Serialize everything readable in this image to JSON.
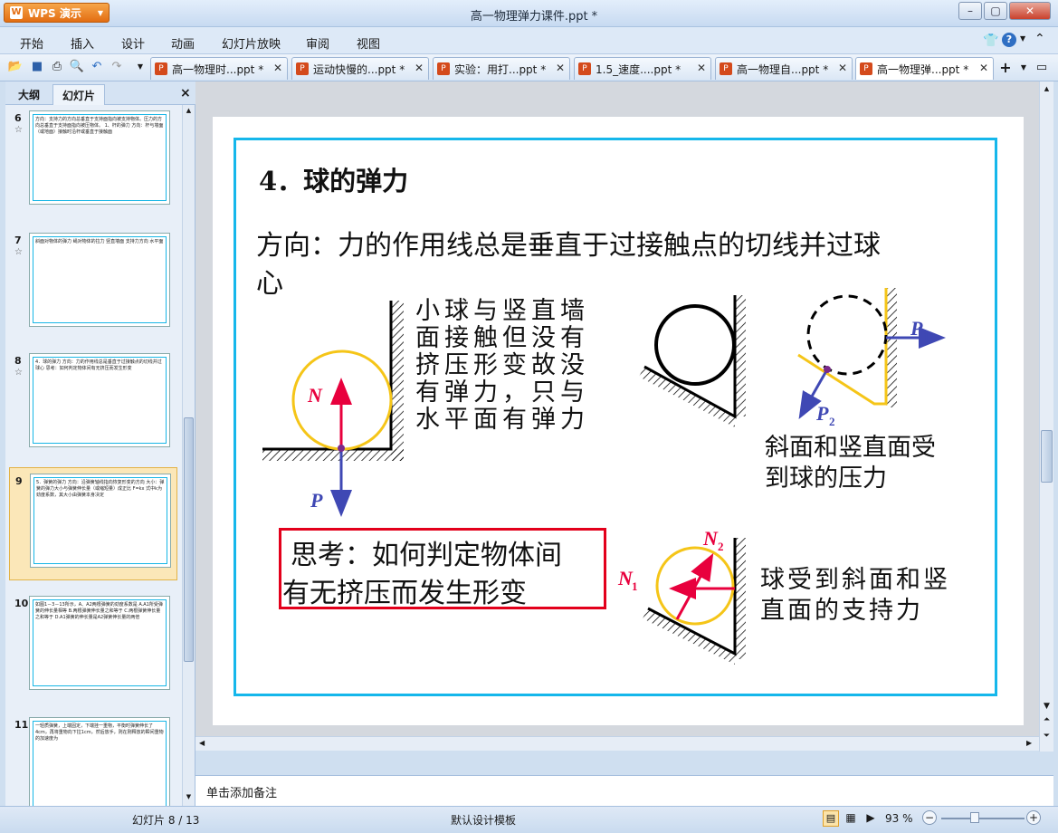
{
  "window": {
    "app_button": "WPS 演示",
    "title": "高一物理弹力课件.ppt *",
    "controls": [
      "–",
      "▢",
      "✕"
    ]
  },
  "menu": [
    "开始",
    "插入",
    "设计",
    "动画",
    "幻灯片放映",
    "审阅",
    "视图"
  ],
  "doc_tabs": [
    {
      "label": "高一物理时...ppt *"
    },
    {
      "label": "运动快慢的...ppt *"
    },
    {
      "label": "实验：用打...ppt *"
    },
    {
      "label": "1.5_速度....ppt *"
    },
    {
      "label": "高一物理自...ppt *"
    },
    {
      "label": "高一物理弹...ppt *"
    }
  ],
  "pane": {
    "tab_outline": "大纲",
    "tab_slides": "幻灯片",
    "close": "×"
  },
  "thumbnails": [
    {
      "num": "6",
      "star": "☆",
      "text": "方向：支持力的方向总垂直于支持面指向被支持物体。压力的方向总垂直于支持面指向被压物体。 1、杆的弹力 方向：杆与墙面（或地面）接触时沿杆或垂直于接触面"
    },
    {
      "num": "7",
      "star": "☆",
      "text": "斜面对物体的弹力 绳对物体的拉力 竖直墙面 支持力方向 水平面"
    },
    {
      "num": "8",
      "star": "☆",
      "text": "4．球的弹力 方向：力的作用线总是垂直于过接触点的切线并过球心 思考：如何判定物体间有无挤压而发生形变"
    },
    {
      "num": "9",
      "star": "",
      "text": "5．弹簧的弹力 方向：沿弹簧轴线指向恢复形变的方向 大小：弹簧的弹力大小与弹簧伸长量（或缩短量）成正比 F=kx 式中k为劲度系数，其大小由弹簧本身决定"
    },
    {
      "num": "10",
      "star": "",
      "text": "如图1－3－13所示，A、A2两根弹簧的劲度系数是 A.A1所受弹簧的伸长量相等 B.两根弹簧伸长量之和等于 C.两根弹簧伸长量之和等于 D.A1弹簧的伸长量是A2弹簧伸长量的两倍"
    },
    {
      "num": "11",
      "star": "",
      "text": "一轻质弹簧，上端固定，下端挂一重物，平衡时弹簧伸长了4cm，再将重物向下拉1cm，然后放手，则在刚释放的瞬间重物的加速度为"
    }
  ],
  "slide": {
    "title": "4．球的弹力",
    "direction_line1": "方向：力的作用线总是垂直于过接触点的切线并过球",
    "direction_line2": "心",
    "wall_text": [
      "小球与竖直墙",
      "面接触但没有",
      "挤压形变故没",
      "有弹力，只与",
      "水平面有弹力"
    ],
    "label_N": "N",
    "label_P": "P",
    "label_P1": "P",
    "label_P1_sub": "1",
    "label_P2": "P",
    "label_P2_sub": "2",
    "pressure_text": [
      "斜面和竖直面受",
      "到球的压力"
    ],
    "think_line1": "思考：如何判定物体间",
    "think_line2": "有无挤压而发生形变",
    "label_N1": "N",
    "label_N1_sub": "1",
    "label_N2": "N",
    "label_N2_sub": "2",
    "support_text": [
      "球受到斜面和竖",
      "直面的支持力"
    ]
  },
  "notes_placeholder": "单击添加备注",
  "status": {
    "slide_counter": "幻灯片 8 / 13",
    "template": "默认设计模板",
    "zoom": "93 %"
  },
  "colors": {
    "frame": "#15b7eb",
    "ball": "#f5c518",
    "arrow_red": "#e8003d",
    "arrow_blue": "#3f48b4",
    "think_box": "#e3001b"
  }
}
